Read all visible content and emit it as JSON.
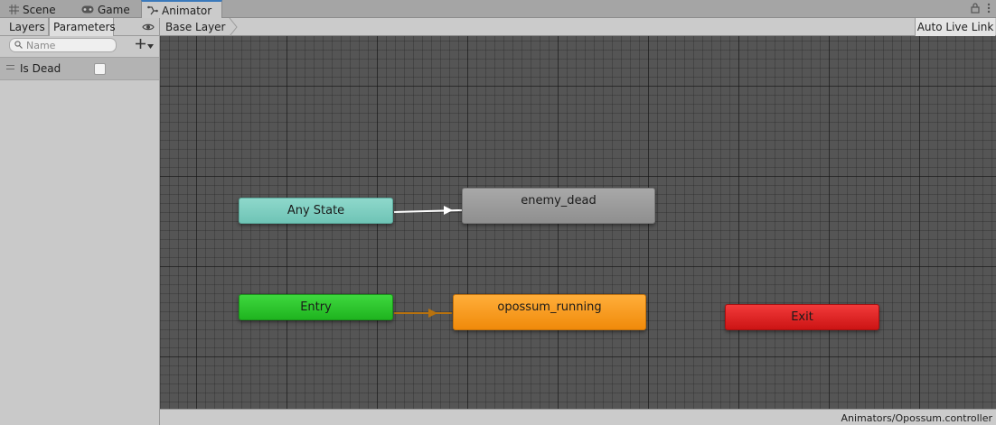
{
  "window": {
    "tabs": [
      {
        "label": "Scene",
        "icon": "grid-icon"
      },
      {
        "label": "Game",
        "icon": "gamepad-icon"
      },
      {
        "label": "Animator",
        "icon": "animator-icon",
        "active": true
      }
    ]
  },
  "left_panel": {
    "tabs": [
      "Layers",
      "Parameters"
    ],
    "active_tab": "Parameters",
    "search": {
      "placeholder": "Name",
      "value": ""
    },
    "parameters": [
      {
        "name": "Is Dead",
        "type": "bool",
        "value": false
      }
    ]
  },
  "breadcrumb": {
    "layer": "Base Layer",
    "live_link_label": "Auto Live Link"
  },
  "graph": {
    "states": {
      "any_state": "Any State",
      "enemy_dead": "enemy_dead",
      "entry": "Entry",
      "opossum_running": "opossum_running",
      "exit": "Exit"
    },
    "colors": {
      "any_state": "#7ccdbf",
      "enemy_dead": "#9b9b9b",
      "entry": "#2cc52c",
      "default_state": "#f79b1f",
      "exit": "#df2323",
      "transition": "#ffffff",
      "default_transition": "#b8720e"
    }
  },
  "status_bar": {
    "path": "Animators/Opossum.controller"
  }
}
